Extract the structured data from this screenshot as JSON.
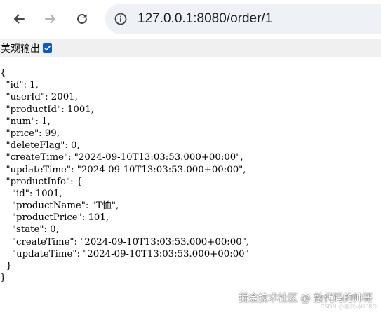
{
  "browser": {
    "url": "127.0.0.1:8080/order/1",
    "icons": {
      "back": "arrow-left",
      "forward": "arrow-right",
      "reload": "reload",
      "site_info": "info-circle"
    }
  },
  "pretty_print": {
    "label": "美观输出",
    "checked": true
  },
  "json_lines": [
    "{",
    "  \"id\": 1,",
    "  \"userId\": 2001,",
    "  \"productId\": 1001,",
    "  \"num\": 1,",
    "  \"price\": 99,",
    "  \"deleteFlag\": 0,",
    "  \"createTime\": \"2024-09-10T13:03:53.000+00:00\",",
    "  \"updateTime\": \"2024-09-10T13:03:53.000+00:00\",",
    "  \"productInfo\": {",
    "    \"id\": 1001,",
    "    \"productName\": \"T恤\",",
    "    \"productPrice\": 101,",
    "    \"state\": 0,",
    "    \"createTime\": \"2024-09-10T13:03:53.000+00:00\",",
    "    \"updateTime\": \"2024-09-10T13:03:53.000+00:00\"",
    "  }",
    "}"
  ],
  "watermark": {
    "main": "掘金技术社区 @ 敲代码的帅哥",
    "sub": "CSDN @敲代码HERO"
  },
  "colors": {
    "omnibox_bg": "#eef1f6",
    "checkbox": "#0b57d0"
  }
}
